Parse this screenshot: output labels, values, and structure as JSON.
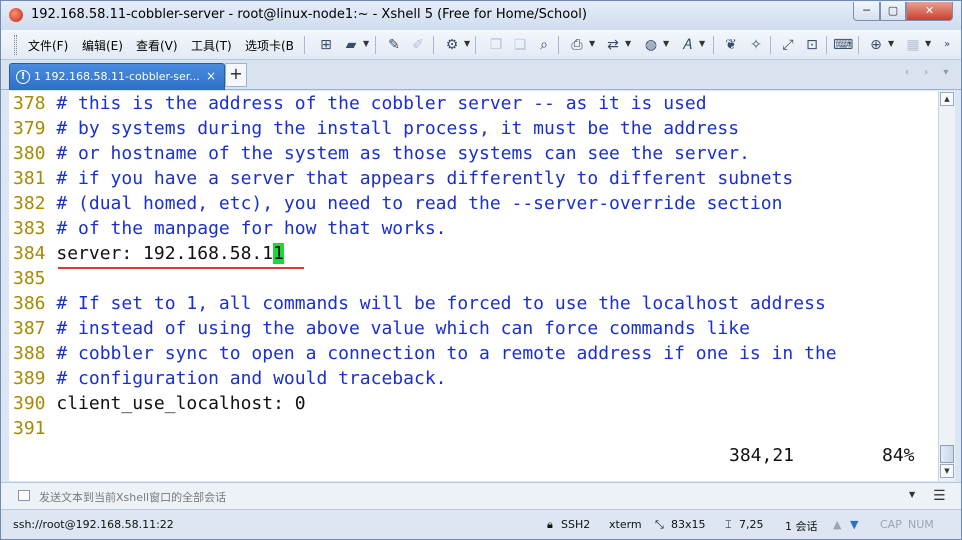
{
  "window": {
    "title": "192.168.58.11-cobbler-server - root@linux-node1:~ - Xshell 5 (Free for Home/School)",
    "minimize_glyph": "─",
    "maximize_glyph": "▢",
    "close_glyph": "✕"
  },
  "menu": {
    "items": [
      "文件(F)",
      "编辑(E)",
      "查看(V)",
      "工具(T)",
      "选项卡(B"
    ]
  },
  "tab": {
    "status_glyph": "!",
    "label": "1 192.168.58.11-cobbler-ser...",
    "close_glyph": "×",
    "add_glyph": "+",
    "nav_glyphs": "‹ › ▾"
  },
  "terminal": {
    "lines": [
      {
        "num": "378",
        "text": "# this is the address of the cobbler server -- as it is used",
        "kind": "comment"
      },
      {
        "num": "379",
        "text": "# by systems during the install process, it must be the address",
        "kind": "comment"
      },
      {
        "num": "380",
        "text": "# or hostname of the system as those systems can see the server.",
        "kind": "comment"
      },
      {
        "num": "381",
        "text": "# if you have a server that appears differently to different subnets",
        "kind": "comment"
      },
      {
        "num": "382",
        "text": "# (dual homed, etc), you need to read the --server-override section",
        "kind": "comment"
      },
      {
        "num": "383",
        "text": "# of the manpage for how that works.",
        "kind": "comment"
      },
      {
        "num": "384",
        "text": "server: 192.168.58.1",
        "cursor_char": "1",
        "kind": "code"
      },
      {
        "num": "385",
        "text": "",
        "kind": "code"
      },
      {
        "num": "386",
        "text": "# If set to 1, all commands will be forced to use the localhost address",
        "kind": "comment"
      },
      {
        "num": "387",
        "text": "# instead of using the above value which can force commands like",
        "kind": "comment"
      },
      {
        "num": "388",
        "text": "# cobbler sync to open a connection to a remote address if one is in the",
        "kind": "comment"
      },
      {
        "num": "389",
        "text": "# configuration and would traceback.",
        "kind": "comment"
      },
      {
        "num": "390",
        "text": "client_use_localhost: 0",
        "kind": "code"
      },
      {
        "num": "391",
        "text": "",
        "kind": "code"
      }
    ],
    "cursor_position": "384,21",
    "scroll_percent": "84%"
  },
  "compose": {
    "placeholder": "发送文本到当前Xshell窗口的全部会话"
  },
  "statusbar": {
    "connection": "ssh://root@192.168.58.11:22",
    "protocol": "SSH2",
    "term_type": "xterm",
    "size": "83x15",
    "cursor": "7,25",
    "sessions": "1 会话",
    "caps": "CAP",
    "num": "NUM"
  },
  "colors": {
    "line_number": "#a68a00",
    "comment": "#1a2fd0",
    "cursor": "#21d63c",
    "tab_active": "#2d6fc6",
    "underline": "#d63a3a"
  }
}
